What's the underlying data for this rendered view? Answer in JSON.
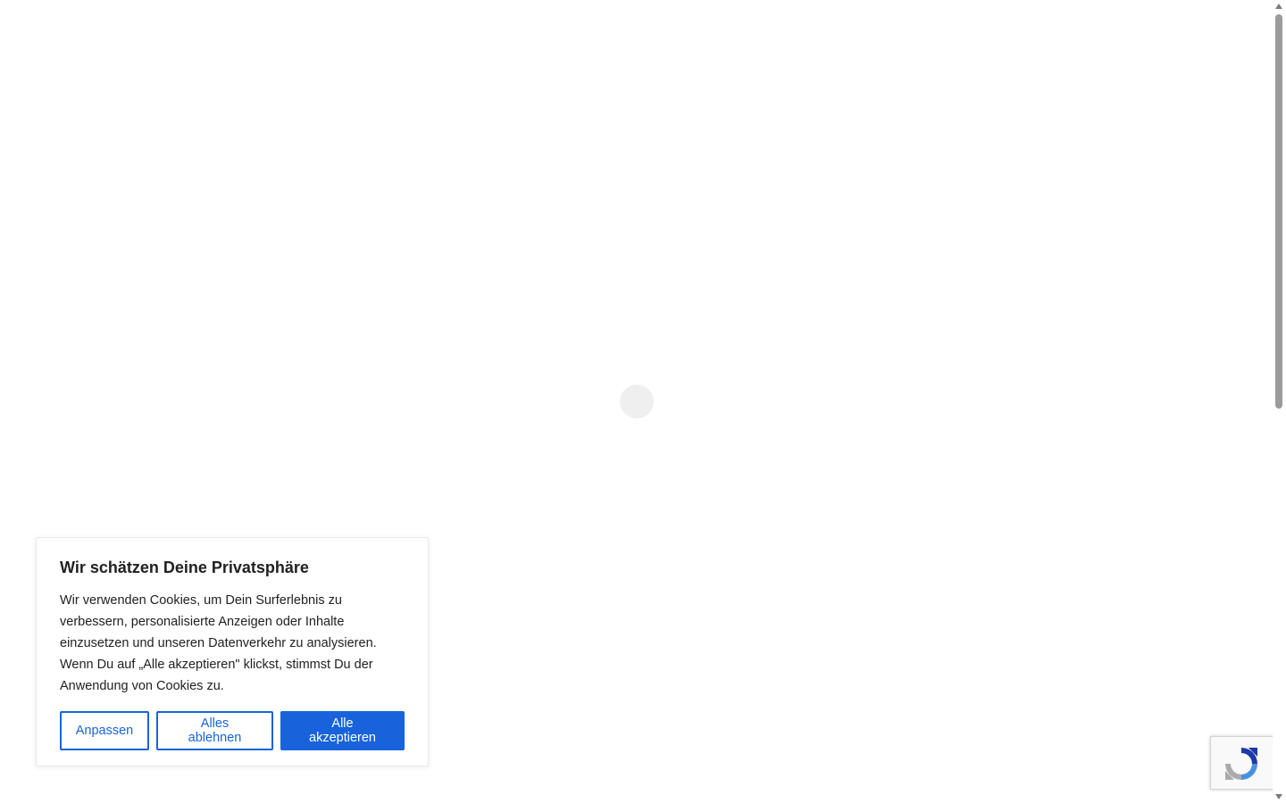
{
  "cookie_banner": {
    "title": "Wir schätzen Deine Privatsphäre",
    "text": "Wir verwenden Cookies, um Dein Surferlebnis zu verbessern, personalisierte Anzeigen oder Inhalte einzusetzen und unseren Datenverkehr zu analysieren. Wenn Du auf „Alle akzeptieren\" klickst, stimmst Du der Anwendung von Cookies zu.",
    "buttons": {
      "customize": "Anpassen",
      "reject_all": "Alles ablehnen",
      "accept_all": "Alle akzeptieren"
    }
  },
  "colors": {
    "accent": "#1863dc",
    "loader": "#efefef"
  },
  "icons": {
    "loader": "loading-spinner-icon",
    "recaptcha": "recaptcha-icon"
  }
}
